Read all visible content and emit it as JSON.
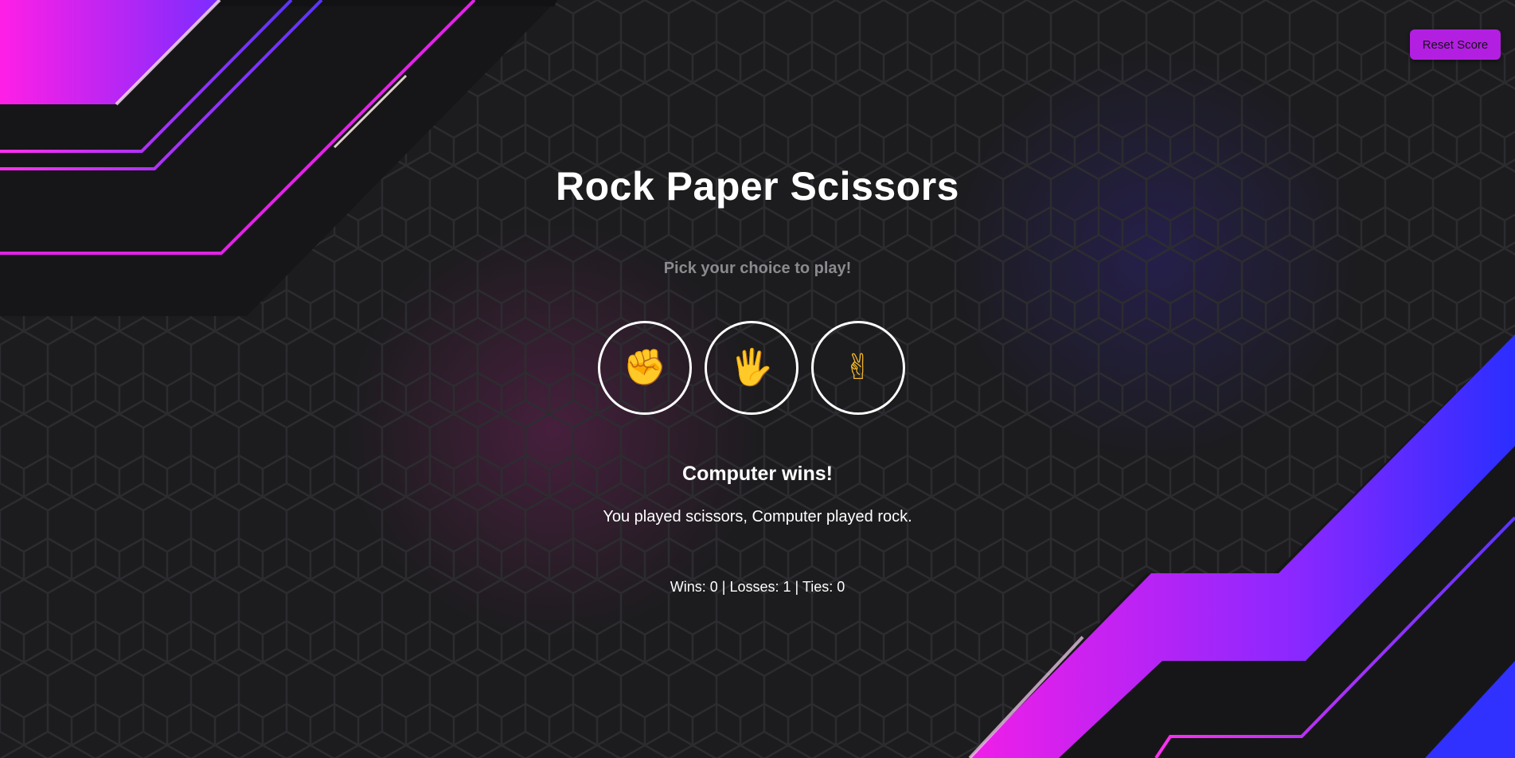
{
  "header": {
    "reset_label": "Reset Score"
  },
  "game": {
    "title": "Rock Paper Scissors",
    "subtitle": "Pick your choice to play!",
    "choices": [
      {
        "name": "rock",
        "emoji": "✊"
      },
      {
        "name": "paper",
        "emoji": "🖐"
      },
      {
        "name": "scissors",
        "emoji": "✌"
      }
    ],
    "result": "Computer wins!",
    "detail": "You played scissors, Computer played rock.",
    "score": "Wins: 0 | Losses: 1 | Ties: 0"
  },
  "colors": {
    "background": "#1c1c1e",
    "accent_magenta": "#e91ee0",
    "accent_blue": "#2d2dff",
    "reset_button": "#b31fe0"
  }
}
